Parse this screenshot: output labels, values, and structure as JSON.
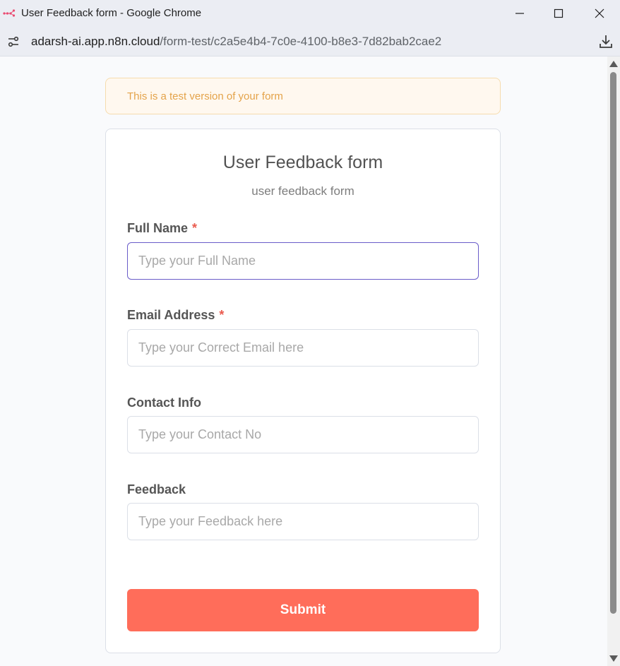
{
  "window": {
    "title": "User Feedback form - Google Chrome",
    "app_icon": "n8n-logo-icon",
    "controls": [
      "minimize-icon",
      "maximize-icon",
      "close-icon"
    ]
  },
  "address_bar": {
    "host": "adarsh-ai.app.n8n.cloud",
    "path": "/form-test/c2a5e4b4-7c0e-4100-b8e3-7d82bab2cae2",
    "site_info_icon": "site-settings-icon",
    "download_icon": "download-icon"
  },
  "banner": {
    "text": "This is a test version of your form"
  },
  "form": {
    "title": "User Feedback form",
    "subtitle": "user feedback form",
    "fields": [
      {
        "label": "Full Name",
        "required_mark": "*",
        "placeholder": "Type your Full Name",
        "value": ""
      },
      {
        "label": "Email Address",
        "required_mark": "*",
        "placeholder": "Type your Correct Email here",
        "value": ""
      },
      {
        "label": "Contact Info",
        "placeholder": "Type your Contact No",
        "value": ""
      },
      {
        "label": "Feedback",
        "placeholder": "Type your Feedback here",
        "value": ""
      }
    ],
    "submit_label": "Submit"
  },
  "colors": {
    "accent": "#ff6d5a",
    "focus_border": "#6a5cc9",
    "banner_bg": "#fff8ef",
    "banner_text": "#e4a34a",
    "required": "#ea5b4f"
  }
}
